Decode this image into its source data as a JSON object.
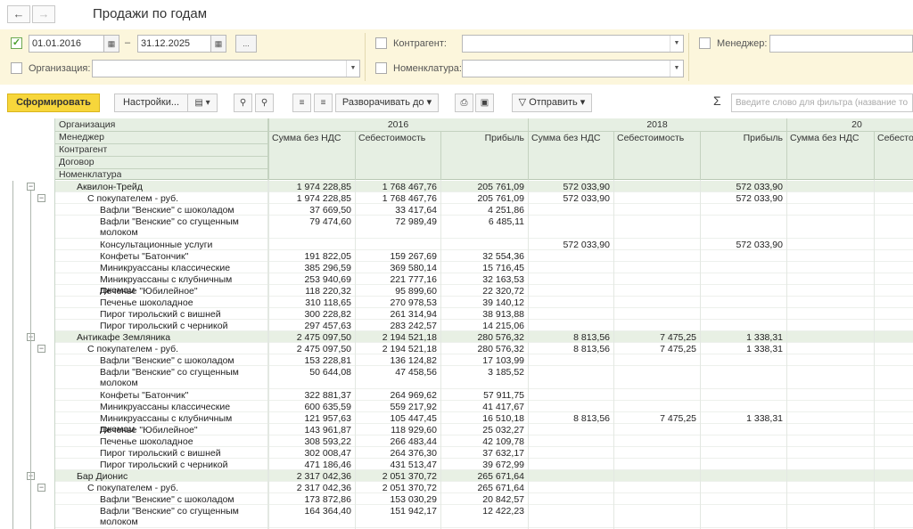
{
  "window": {
    "title": "Продажи по годам",
    "back_arrow": "←",
    "forward_arrow": "→"
  },
  "filters": {
    "period_checked": true,
    "date_from": "01.01.2016",
    "date_sep": "–",
    "date_to": "31.12.2025",
    "ellipsis": "...",
    "organization_label": "Организация:",
    "organization_value": "",
    "counterparty_label": "Контрагент:",
    "counterparty_value": "",
    "nomenclature_label": "Номенклатура:",
    "nomenclature_value": "",
    "manager_label": "Менеджер:",
    "manager_value": ""
  },
  "toolbar": {
    "generate_label": "Сформировать",
    "settings_label": "Настройки...",
    "expand_label": "Разворачивать до",
    "send_label": "Отправить",
    "sigma": "Σ",
    "filter_placeholder": "Введите слово для фильтра (название то"
  },
  "report": {
    "grouping_headers": [
      "Организация",
      "Менеджер",
      "Контрагент",
      "Договор",
      "Номенклатура"
    ],
    "years": [
      "2016",
      "2018",
      "20"
    ],
    "columns": [
      "Сумма без НДС",
      "Себестоимость",
      "Прибыль",
      "Сумма без НДС",
      "Себестоимость",
      "Прибыль",
      "Сумма без НДС",
      "Себесто"
    ],
    "rows": [
      {
        "level": 0,
        "label": "Аквилон-Трейд",
        "v": [
          "1 974 228,85",
          "1 768 467,76",
          "205 761,09",
          "572 033,90",
          "",
          "572 033,90"
        ],
        "h": 13
      },
      {
        "level": 1,
        "label": "С покупателем - руб.",
        "v": [
          "1 974 228,85",
          "1 768 467,76",
          "205 761,09",
          "572 033,90",
          "",
          "572 033,90"
        ],
        "h": 13
      },
      {
        "level": 2,
        "label": "Вафли \"Венские\" с шоколадом",
        "v": [
          "37 669,50",
          "33 417,64",
          "4 251,86",
          "",
          "",
          ""
        ],
        "h": 13
      },
      {
        "level": 2,
        "label": "Вафли \"Венские\" со сгущенным молоком",
        "v": [
          "79 474,60",
          "72 989,49",
          "6 485,11",
          "",
          "",
          ""
        ],
        "h": 26
      },
      {
        "level": 2,
        "label": "Консультационные услуги",
        "v": [
          "",
          "",
          "",
          "572 033,90",
          "",
          "572 033,90"
        ],
        "h": 13
      },
      {
        "level": 2,
        "label": "Конфеты \"Батончик\"",
        "v": [
          "191 822,05",
          "159 267,69",
          "32 554,36",
          "",
          "",
          ""
        ],
        "h": 13
      },
      {
        "level": 2,
        "label": "Миникруассаны классические",
        "v": [
          "385 296,59",
          "369 580,14",
          "15 716,45",
          "",
          "",
          ""
        ],
        "h": 13
      },
      {
        "level": 2,
        "label": "Миникруассаны с клубничным джемом",
        "v": [
          "253 940,69",
          "221 777,16",
          "32 163,53",
          "",
          "",
          ""
        ],
        "h": 13
      },
      {
        "level": 2,
        "label": "Печенье \"Юбилейное\"",
        "v": [
          "118 220,32",
          "95 899,60",
          "22 320,72",
          "",
          "",
          ""
        ],
        "h": 13
      },
      {
        "level": 2,
        "label": "Печенье шоколадное",
        "v": [
          "310 118,65",
          "270 978,53",
          "39 140,12",
          "",
          "",
          ""
        ],
        "h": 13
      },
      {
        "level": 2,
        "label": "Пирог тирольский с вишней",
        "v": [
          "300 228,82",
          "261 314,94",
          "38 913,88",
          "",
          "",
          ""
        ],
        "h": 13
      },
      {
        "level": 2,
        "label": "Пирог тирольский с черникой",
        "v": [
          "297 457,63",
          "283 242,57",
          "14 215,06",
          "",
          "",
          ""
        ],
        "h": 13
      },
      {
        "level": 0,
        "label": "Антикафе Земляника",
        "v": [
          "2 475 097,50",
          "2 194 521,18",
          "280 576,32",
          "8 813,56",
          "7 475,25",
          "1 338,31"
        ],
        "h": 13
      },
      {
        "level": 1,
        "label": "С покупателем - руб.",
        "v": [
          "2 475 097,50",
          "2 194 521,18",
          "280 576,32",
          "8 813,56",
          "7 475,25",
          "1 338,31"
        ],
        "h": 13
      },
      {
        "level": 2,
        "label": "Вафли \"Венские\" с шоколадом",
        "v": [
          "153 228,81",
          "136 124,82",
          "17 103,99",
          "",
          "",
          ""
        ],
        "h": 13
      },
      {
        "level": 2,
        "label": "Вафли \"Венские\" со сгущенным молоком",
        "v": [
          "50 644,08",
          "47 458,56",
          "3 185,52",
          "",
          "",
          ""
        ],
        "h": 26
      },
      {
        "level": 2,
        "label": "Конфеты \"Батончик\"",
        "v": [
          "322 881,37",
          "264 969,62",
          "57 911,75",
          "",
          "",
          ""
        ],
        "h": 13
      },
      {
        "level": 2,
        "label": "Миникруассаны классические",
        "v": [
          "600 635,59",
          "559 217,92",
          "41 417,67",
          "",
          "",
          ""
        ],
        "h": 13
      },
      {
        "level": 2,
        "label": "Миникруассаны с клубничным джемом",
        "v": [
          "121 957,63",
          "105 447,45",
          "16 510,18",
          "8 813,56",
          "7 475,25",
          "1 338,31"
        ],
        "h": 13
      },
      {
        "level": 2,
        "label": "Печенье \"Юбилейное\"",
        "v": [
          "143 961,87",
          "118 929,60",
          "25 032,27",
          "",
          "",
          ""
        ],
        "h": 13
      },
      {
        "level": 2,
        "label": "Печенье шоколадное",
        "v": [
          "308 593,22",
          "266 483,44",
          "42 109,78",
          "",
          "",
          ""
        ],
        "h": 13
      },
      {
        "level": 2,
        "label": "Пирог тирольский с вишней",
        "v": [
          "302 008,47",
          "264 376,30",
          "37 632,17",
          "",
          "",
          ""
        ],
        "h": 13
      },
      {
        "level": 2,
        "label": "Пирог тирольский с черникой",
        "v": [
          "471 186,46",
          "431 513,47",
          "39 672,99",
          "",
          "",
          ""
        ],
        "h": 13
      },
      {
        "level": 0,
        "label": "Бар Дионис",
        "v": [
          "2 317 042,36",
          "2 051 370,72",
          "265 671,64",
          "",
          "",
          ""
        ],
        "h": 13
      },
      {
        "level": 1,
        "label": "С покупателем - руб.",
        "v": [
          "2 317 042,36",
          "2 051 370,72",
          "265 671,64",
          "",
          "",
          ""
        ],
        "h": 13
      },
      {
        "level": 2,
        "label": "Вафли \"Венские\" с шоколадом",
        "v": [
          "173 872,86",
          "153 030,29",
          "20 842,57",
          "",
          "",
          ""
        ],
        "h": 13
      },
      {
        "level": 2,
        "label": "Вафли \"Венские\" со сгущенным молоком",
        "v": [
          "164 364,40",
          "151 942,17",
          "12 422,23",
          "",
          "",
          ""
        ],
        "h": 26
      }
    ]
  }
}
